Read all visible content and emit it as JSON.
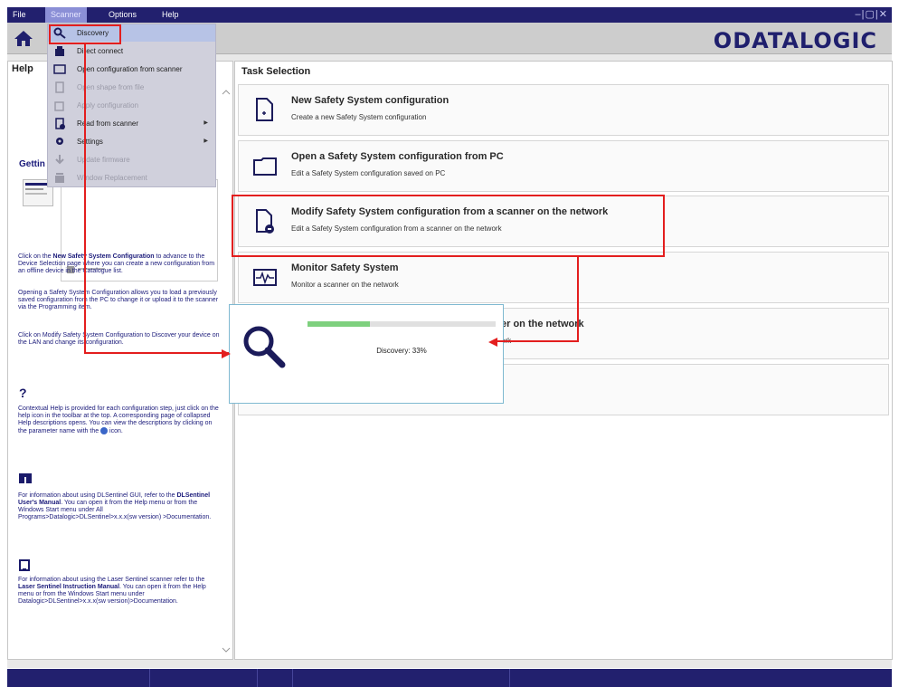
{
  "menubar": {
    "items": [
      {
        "label": "File"
      },
      {
        "label": "Scanner"
      },
      {
        "label": "Options"
      },
      {
        "label": "Help"
      }
    ],
    "window_controls": "–|▢|✕"
  },
  "toolbar": {
    "home_icon": "home-icon",
    "logo": "ODATALOGIC"
  },
  "scanner_menu": {
    "items": [
      {
        "label": "Discovery",
        "icon": "search-icon",
        "enabled": true,
        "selected": true
      },
      {
        "label": "Direct connect",
        "icon": "connect-icon",
        "enabled": true
      },
      {
        "label": "Open configuration from scanner",
        "icon": "folder-icon",
        "enabled": true
      },
      {
        "label": "Open shape from file",
        "icon": "file-icon",
        "enabled": false
      },
      {
        "label": "Apply configuration",
        "icon": "apply-icon",
        "enabled": false
      },
      {
        "label": "Read from scanner",
        "icon": "read-icon",
        "enabled": true,
        "submenu": true
      },
      {
        "label": "Settings",
        "icon": "settings-icon",
        "enabled": true,
        "submenu": true
      },
      {
        "label": "Update firmware",
        "icon": "firmware-icon",
        "enabled": false
      },
      {
        "label": "Window Replacement",
        "icon": "replace-icon",
        "enabled": false
      }
    ]
  },
  "help": {
    "title": "Help",
    "getting": "Gettin",
    "p1_pre": "Click on the ",
    "p1_bold": "New Safety System Configuration",
    "p1_post": " to advance to the Device Selection page where you can create a new configuration from an offline device in the Catalogue list.",
    "p2": "Opening a Safety System Configuration allows you to load a previously saved configuration from the PC to change it or upload it to the scanner via the Programming item.",
    "p3": "Click on Modify Safety System Configuration to Discover your device on the LAN and change its configuration.",
    "q_mark": "?",
    "p4": "Contextual Help is provided for each configuration step, just click on the help icon in the toolbar at the top. A corresponding page of collapsed Help descriptions opens. You can view the descriptions by clicking on the parameter name with the",
    "p4_tail": " icon.",
    "p5_pre": "For information about using DLSentinel GUI, refer to the ",
    "p5_bold": "DLSentinel User's Manual",
    "p5_post": ". You can open it from the Help menu or from the Windows Start menu under All Programs>Datalogic>DLSentinel>x.x.x(sw version) >Documentation.",
    "p6_pre": "For information about using the Laser Sentinel scanner refer to the ",
    "p6_bold": "Laser Sentinel Instruction Manual",
    "p6_post": ". You can open it from the Help menu or from the Windows Start menu under Datalogic>DLSentinel>x.x.x(sw version)>Documentation."
  },
  "task_selection": {
    "title": "Task Selection",
    "tasks": [
      {
        "title": "New Safety System configuration",
        "desc": "Create a new Safety System configuration",
        "icon": "new-file-icon"
      },
      {
        "title": "Open a Safety System configuration from PC",
        "desc": "Edit a Safety System configuration saved on PC",
        "icon": "folder-icon"
      },
      {
        "title": "Modify Safety System configuration from a scanner on the network",
        "desc": "Edit a Safety System configuration from a scanner on the network",
        "icon": "file-scanner-icon"
      },
      {
        "title": "Monitor Safety System",
        "desc": "Monitor a scanner on the network",
        "icon": "monitor-icon"
      },
      {
        "title": "er on the network",
        "desc": "ork",
        "icon": ""
      },
      {
        "title": "",
        "desc": "",
        "icon": ""
      }
    ]
  },
  "discovery": {
    "icon": "search-icon",
    "progress": 0.33,
    "label": "Discovery: 33%"
  },
  "colors": {
    "menubar": "#22206e",
    "annotation": "#e31e1e",
    "progress": "#7ed07e"
  }
}
